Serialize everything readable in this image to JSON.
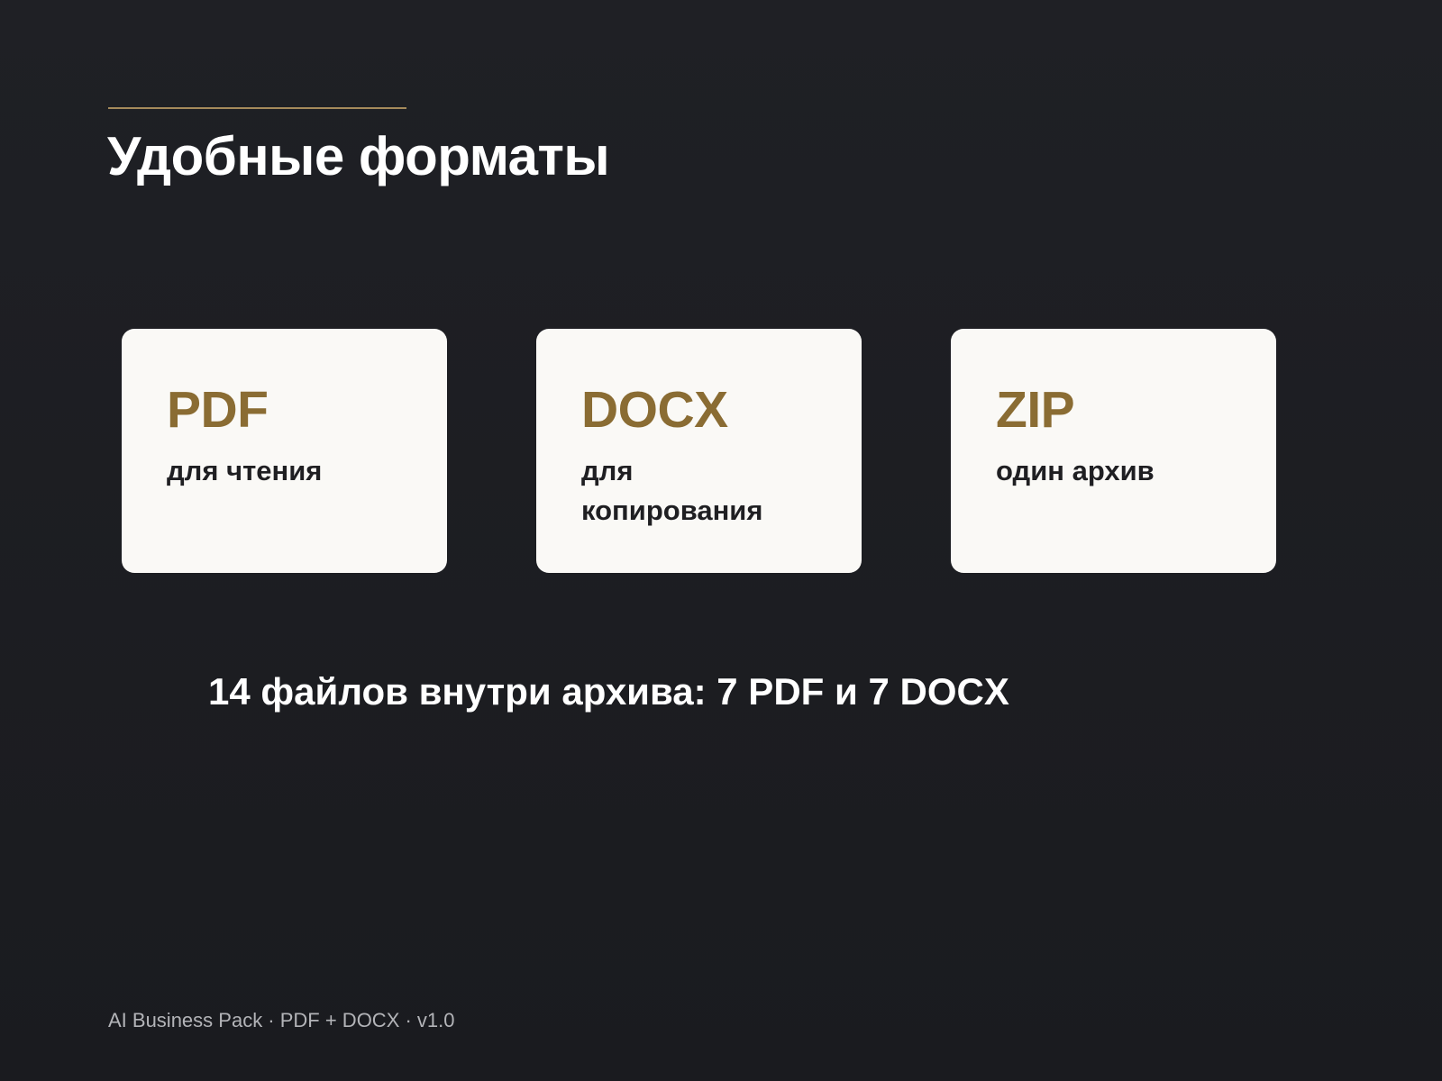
{
  "title": "Удобные форматы",
  "formats": [
    {
      "name": "PDF",
      "description": "для чтения"
    },
    {
      "name": "DOCX",
      "description": "для копирования"
    },
    {
      "name": "ZIP",
      "description": "один архив"
    }
  ],
  "summary": "14 файлов внутри архива: 7 PDF и 7 DOCX",
  "footer": "AI Business Pack · PDF + DOCX · v1.0",
  "colors": {
    "background": "#1c1d21",
    "accent": "#8a6c33",
    "card_background": "#faf9f6",
    "title_text": "#ffffff",
    "card_text": "#1f1f22",
    "footer_text": "#b3b4b8"
  }
}
